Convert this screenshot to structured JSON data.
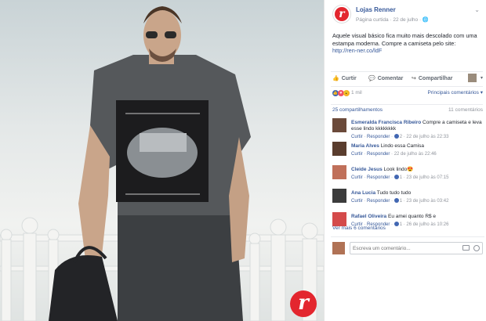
{
  "post": {
    "page_name": "Lojas Renner",
    "meta": "Página curtida · 22 de julho · ",
    "text": "Aquele visual básico fica muito mais descolado com uma estampa moderna. Compre a camiseta pelo site: ",
    "link": "http://ren-ner.co/ldF",
    "brand_letter": "r"
  },
  "actions": {
    "like": "Curtir",
    "comment": "Comentar",
    "share": "Compartilhar"
  },
  "reactions": {
    "count": "1 mil",
    "relevant": "Principais comentários"
  },
  "stats": {
    "shares": "25 compartilhamentos",
    "comments": "11 comentários"
  },
  "comments": [
    {
      "name": "Esmeralda Francisca Ribeiro",
      "text": " Compre a camiseta e leva esse lindo kkkkkkkk",
      "like": "Curtir",
      "reply": "Responder",
      "likes": "2",
      "time": "22 de julho às 22:33",
      "avatar_color": "#6b4a3a"
    },
    {
      "name": "Maria Alves",
      "text": " Lindo essa Camisa",
      "like": "Curtir",
      "reply": "Responder",
      "likes": "",
      "time": "22 de julho às 22:46",
      "avatar_color": "#5a3d2e"
    },
    {
      "name": "Cleide Jesus",
      "text": " Look lindo😍",
      "like": "Curtir",
      "reply": "Responder",
      "likes": "1",
      "time": "23 de julho às 07:15",
      "avatar_color": "#c0705a"
    },
    {
      "name": "Ana Lucia",
      "text": " Tudo tudo tudo",
      "like": "Curtir",
      "reply": "Responder",
      "likes": "1",
      "time": "23 de julho às 03:42",
      "avatar_color": "#3c3c3c"
    },
    {
      "name": "Rafael Oliveira",
      "text": " Eu amei quanto R$ e",
      "like": "Curtir",
      "reply": "Responder",
      "likes": "1",
      "time": "26 de julho às 10:26",
      "avatar_color": "#d44a4a"
    }
  ],
  "more_comments": "Ver mais 6 comentários",
  "compose": {
    "placeholder": "Escreva um comentário..."
  }
}
